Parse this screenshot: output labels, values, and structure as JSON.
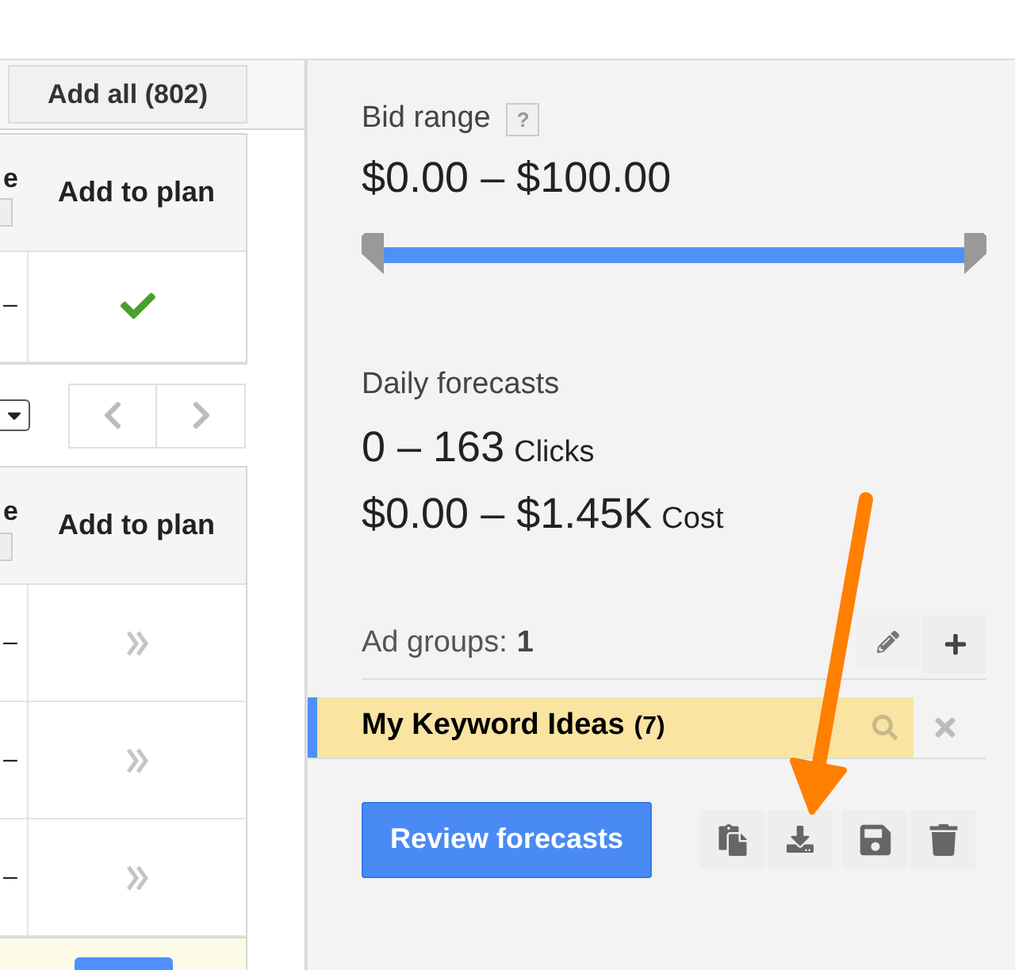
{
  "toolbar": {
    "add_all_button": "Add all (802)"
  },
  "table_top": {
    "columns": [
      {
        "label": "e",
        "help": true
      },
      {
        "label": "Add to plan"
      }
    ],
    "rows": [
      {
        "column_1": "–",
        "in_plan": true
      }
    ]
  },
  "pagination": {
    "page_size_dropdown": true
  },
  "table_bottom": {
    "columns": [
      {
        "label": "e",
        "help": true
      },
      {
        "label": "Add to plan"
      }
    ],
    "rows": [
      {
        "column_1": "–",
        "in_plan": false
      },
      {
        "column_1": "–",
        "in_plan": false
      },
      {
        "column_1": "–",
        "in_plan": false
      }
    ]
  },
  "plan_panel": {
    "bid_range": {
      "label": "Bid range",
      "help": "?",
      "value": "$0.00 – $100.00",
      "slider": {
        "level": 1
      }
    },
    "daily_forecasts": {
      "label": "Daily forecasts",
      "clicks_value": "0 – 163",
      "clicks_unit": "Clicks",
      "cost_value": "$0.00 – $1.45K",
      "cost_unit": "Cost"
    },
    "ad_groups": {
      "label": "Ad groups:",
      "count": "1"
    },
    "ad_group_items": [
      {
        "name": "My Keyword Ideas",
        "count": "(7)",
        "selected": true
      }
    ],
    "review_button": "Review forecasts"
  }
}
